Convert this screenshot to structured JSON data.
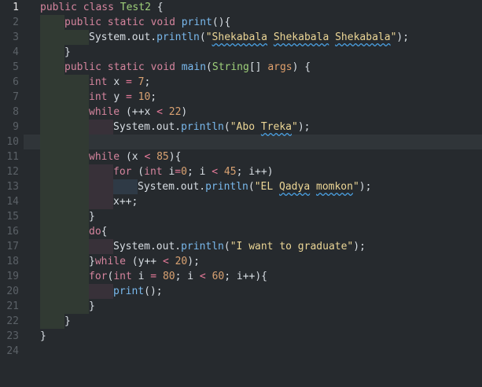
{
  "gutter": {
    "line_numbers": [
      "1",
      "2",
      "3",
      "4",
      "5",
      "6",
      "7",
      "8",
      "9",
      "10",
      "11",
      "12",
      "13",
      "14",
      "15",
      "16",
      "17",
      "18",
      "19",
      "20",
      "21",
      "22",
      "23",
      "24"
    ]
  },
  "code": {
    "line1": {
      "kw1": "public",
      "kw2": "class",
      "name": "Test2",
      "tail": " {"
    },
    "line2": {
      "kw1": "public",
      "kw2": "static",
      "kw3": "void",
      "fn": "print",
      "tail": "(){"
    },
    "line3": {
      "pre": "System.out.",
      "fn": "println",
      "open": "(",
      "str1": "\"",
      "s1": "Shekabala",
      "sp1": " ",
      "s2": "Shekabala",
      "sp2": " ",
      "s3": "Shekabala",
      "str2": "\"",
      "close": ");"
    },
    "line4": {
      "text": "}"
    },
    "line5": {
      "kw1": "public",
      "kw2": "static",
      "kw3": "void",
      "fn": "main",
      "open": "(",
      "type": "String",
      "arr": "[]",
      "param": "args",
      "close": ") {"
    },
    "line6": {
      "kw": "int",
      "var": "x",
      "op": "=",
      "num": "7",
      "end": ";"
    },
    "line7": {
      "kw": "int",
      "var": "y",
      "op": "=",
      "num": "10",
      "end": ";"
    },
    "line8": {
      "kw": "while",
      "pre": " (++x ",
      "op": "<",
      "num": "22",
      "end": ")"
    },
    "line9": {
      "pre": "System.out.",
      "fn": "println",
      "open": "(",
      "q1": "\"Abo ",
      "word": "Treka",
      "q2": "\"",
      "close": ");"
    },
    "line11": {
      "kw": "while",
      "pre": " (x ",
      "op": "<",
      "num": "85",
      "end": "){"
    },
    "line12": {
      "kw": "for",
      "pre": " (",
      "kw2": "int",
      "var": " i",
      "op1": "=",
      "num1": "0",
      "mid": "; i ",
      "op2": "<",
      "num2": "45",
      "end": "; i++)"
    },
    "line13": {
      "pre": "System.out.",
      "fn": "println",
      "open": "(",
      "q1": "\"EL ",
      "w1": "Qadya",
      "sp": " ",
      "w2": "momkon",
      "q2": "\"",
      "close": ");"
    },
    "line14": {
      "text": "x++;"
    },
    "line15": {
      "text": "}"
    },
    "line16": {
      "kw": "do",
      "tail": "{"
    },
    "line17": {
      "pre": "System.out.",
      "fn": "println",
      "open": "(",
      "str": "\"I want to graduate\"",
      "close": ");"
    },
    "line18": {
      "pre": "}",
      "kw": "while",
      "mid": " (y++ ",
      "op": "<",
      "num": "20",
      "end": ");"
    },
    "line19": {
      "kw": "for",
      "pre": "(",
      "kw2": "int",
      "var": " i ",
      "op1": "=",
      "num1": "80",
      "mid": "; i ",
      "op2": "<",
      "num2": "60",
      "end": "; i++){"
    },
    "line20": {
      "fn": "print",
      "tail": "();"
    },
    "line21": {
      "text": "}"
    },
    "line22": {
      "text": "}"
    },
    "line23": {
      "text": "}"
    }
  }
}
